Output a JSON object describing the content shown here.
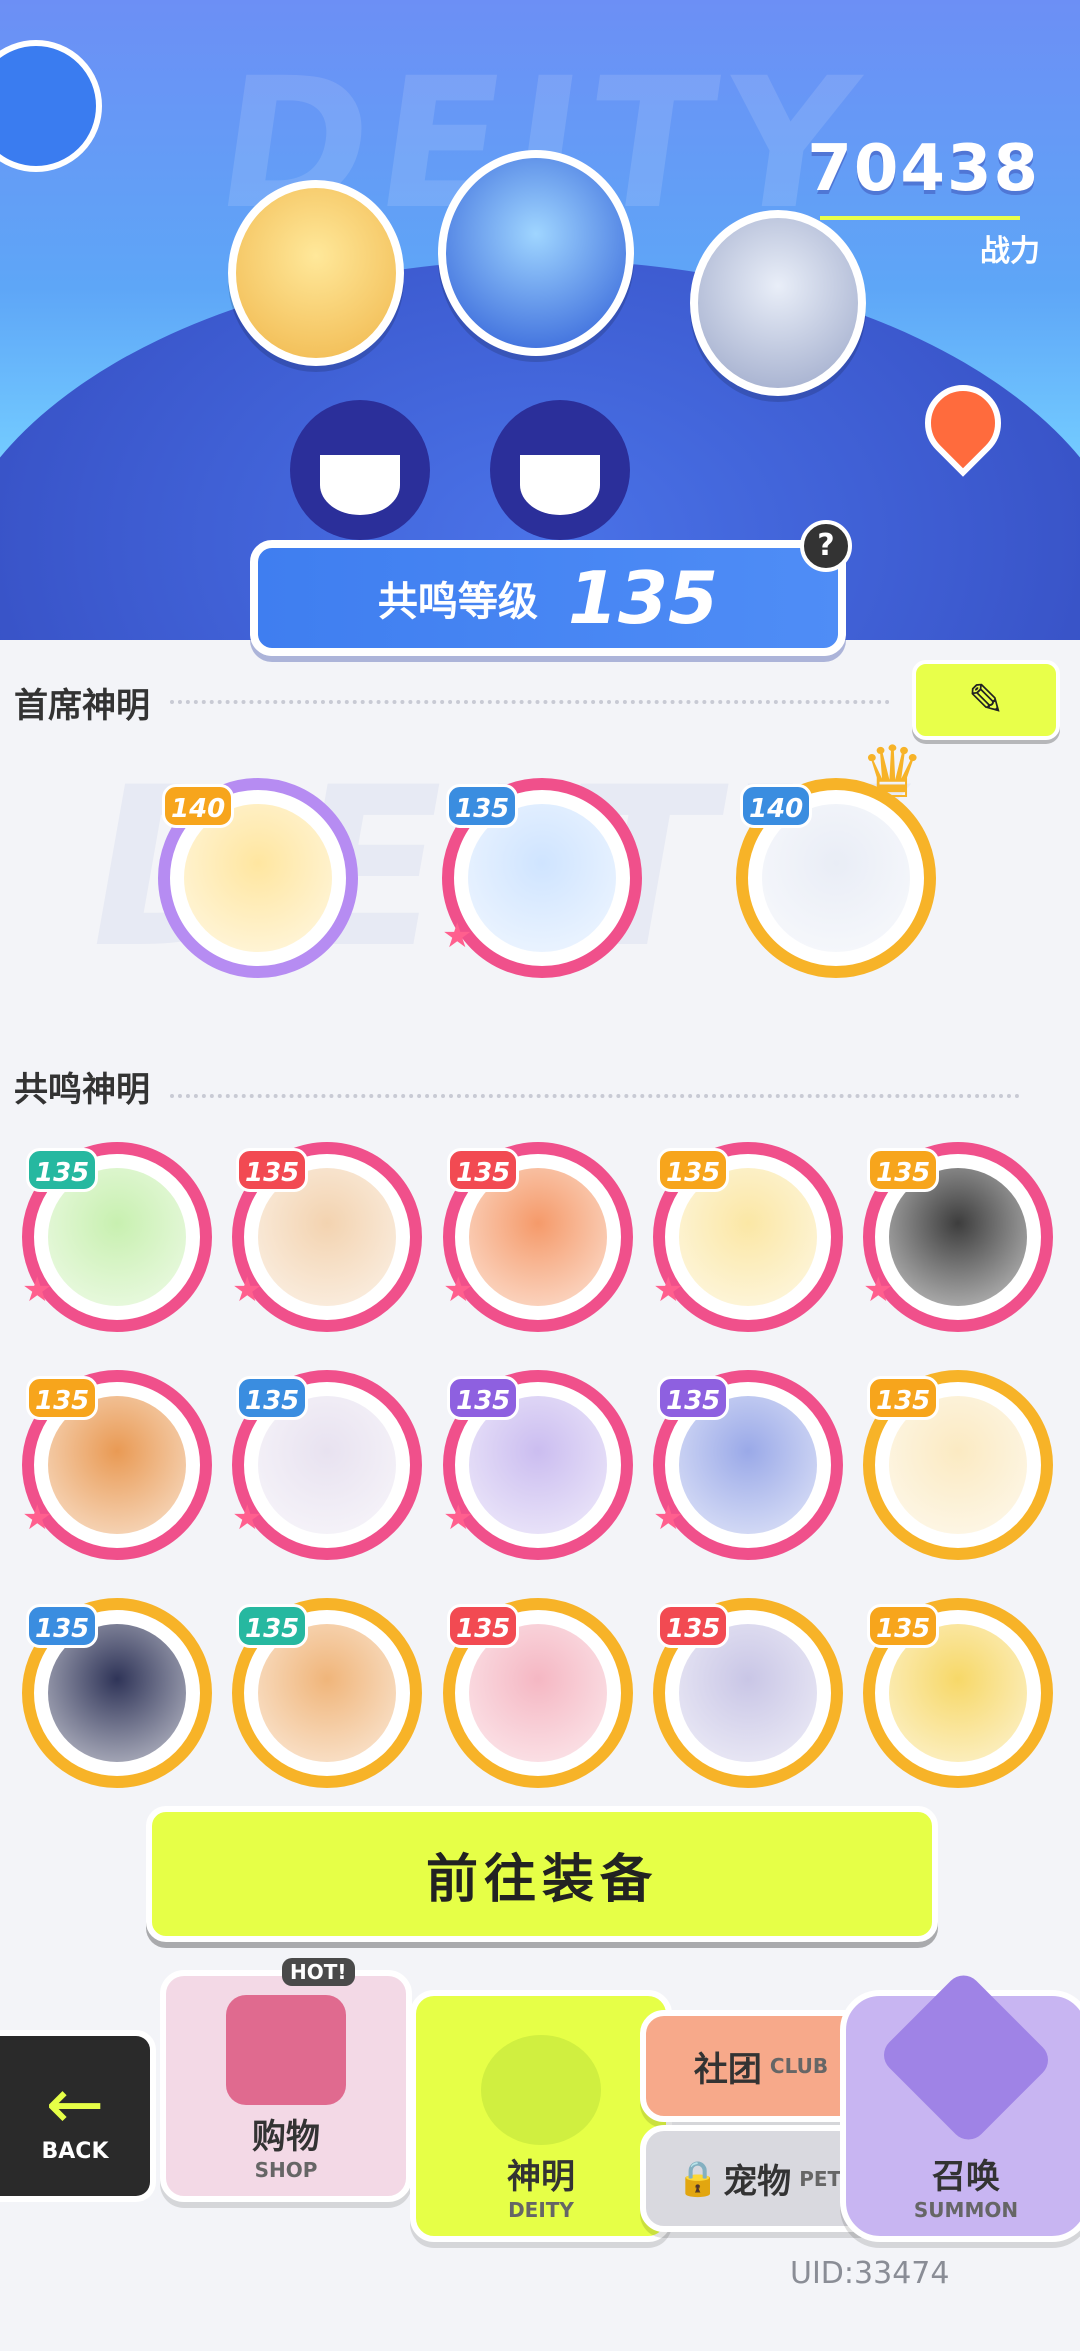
{
  "header": {
    "bg_word": "DEITY",
    "power_value": "70438",
    "power_label": "战力",
    "resonance_label": "共鸣等级",
    "resonance_level": "135",
    "help_symbol": "?"
  },
  "chief": {
    "title": "首席神明",
    "edit_icon": "✎",
    "bg_word": "DEITY",
    "members": [
      {
        "level": "140",
        "frame": "purple",
        "badge": "gold",
        "icon": "blonde-girl-portrait"
      },
      {
        "level": "135",
        "frame": "pink",
        "badge": "blue",
        "icon": "blue-hair-girl-portrait"
      },
      {
        "level": "140",
        "frame": "gold",
        "badge": "blue",
        "icon": "silver-hair-boy-portrait"
      }
    ]
  },
  "resonance": {
    "title": "共鸣神明",
    "members": [
      {
        "level": "135",
        "frame": "pink",
        "badge": "teal",
        "face": "#c8f0b0"
      },
      {
        "level": "135",
        "frame": "pink",
        "badge": "red",
        "face": "#f3d3b0"
      },
      {
        "level": "135",
        "frame": "pink",
        "badge": "red",
        "face": "#f59a6a"
      },
      {
        "level": "135",
        "frame": "pink",
        "badge": "gold",
        "face": "#fbe7a5"
      },
      {
        "level": "135",
        "frame": "pink",
        "badge": "gold",
        "face": "#3d3d3d"
      },
      {
        "level": "135",
        "frame": "pink",
        "badge": "gold",
        "face": "#e99a54"
      },
      {
        "level": "135",
        "frame": "pink",
        "badge": "blue",
        "face": "#e8e2f0"
      },
      {
        "level": "135",
        "frame": "pink",
        "badge": "purple",
        "face": "#cbbdf0"
      },
      {
        "level": "135",
        "frame": "pink",
        "badge": "purple",
        "face": "#9aa9e8"
      },
      {
        "level": "135",
        "frame": "gold",
        "badge": "gold",
        "face": "#fbeac2"
      },
      {
        "level": "135",
        "frame": "gold",
        "badge": "blue",
        "face": "#2f3458"
      },
      {
        "level": "135",
        "frame": "gold",
        "badge": "teal",
        "face": "#f0b57a"
      },
      {
        "level": "135",
        "frame": "gold",
        "badge": "red",
        "face": "#f5b7c3"
      },
      {
        "level": "135",
        "frame": "gold",
        "badge": "red",
        "face": "#c9c6e6"
      },
      {
        "level": "135",
        "frame": "gold",
        "badge": "gold",
        "face": "#f7d868"
      }
    ]
  },
  "actions": {
    "go_equip": "前往装备"
  },
  "nav": {
    "back_icon": "←",
    "back": "BACK",
    "hot": "HOT!",
    "shop_cn": "购物",
    "shop_en": "SHOP",
    "deity_cn": "神明",
    "deity_en": "DEITY",
    "club_cn": "社团",
    "club_en": "CLUB",
    "pet_cn": "宠物",
    "pet_en": "PET",
    "summon_cn": "召唤",
    "summon_en": "SUMMON",
    "lock_icon": "🔒"
  },
  "footer": {
    "uid": "UID:33474"
  }
}
